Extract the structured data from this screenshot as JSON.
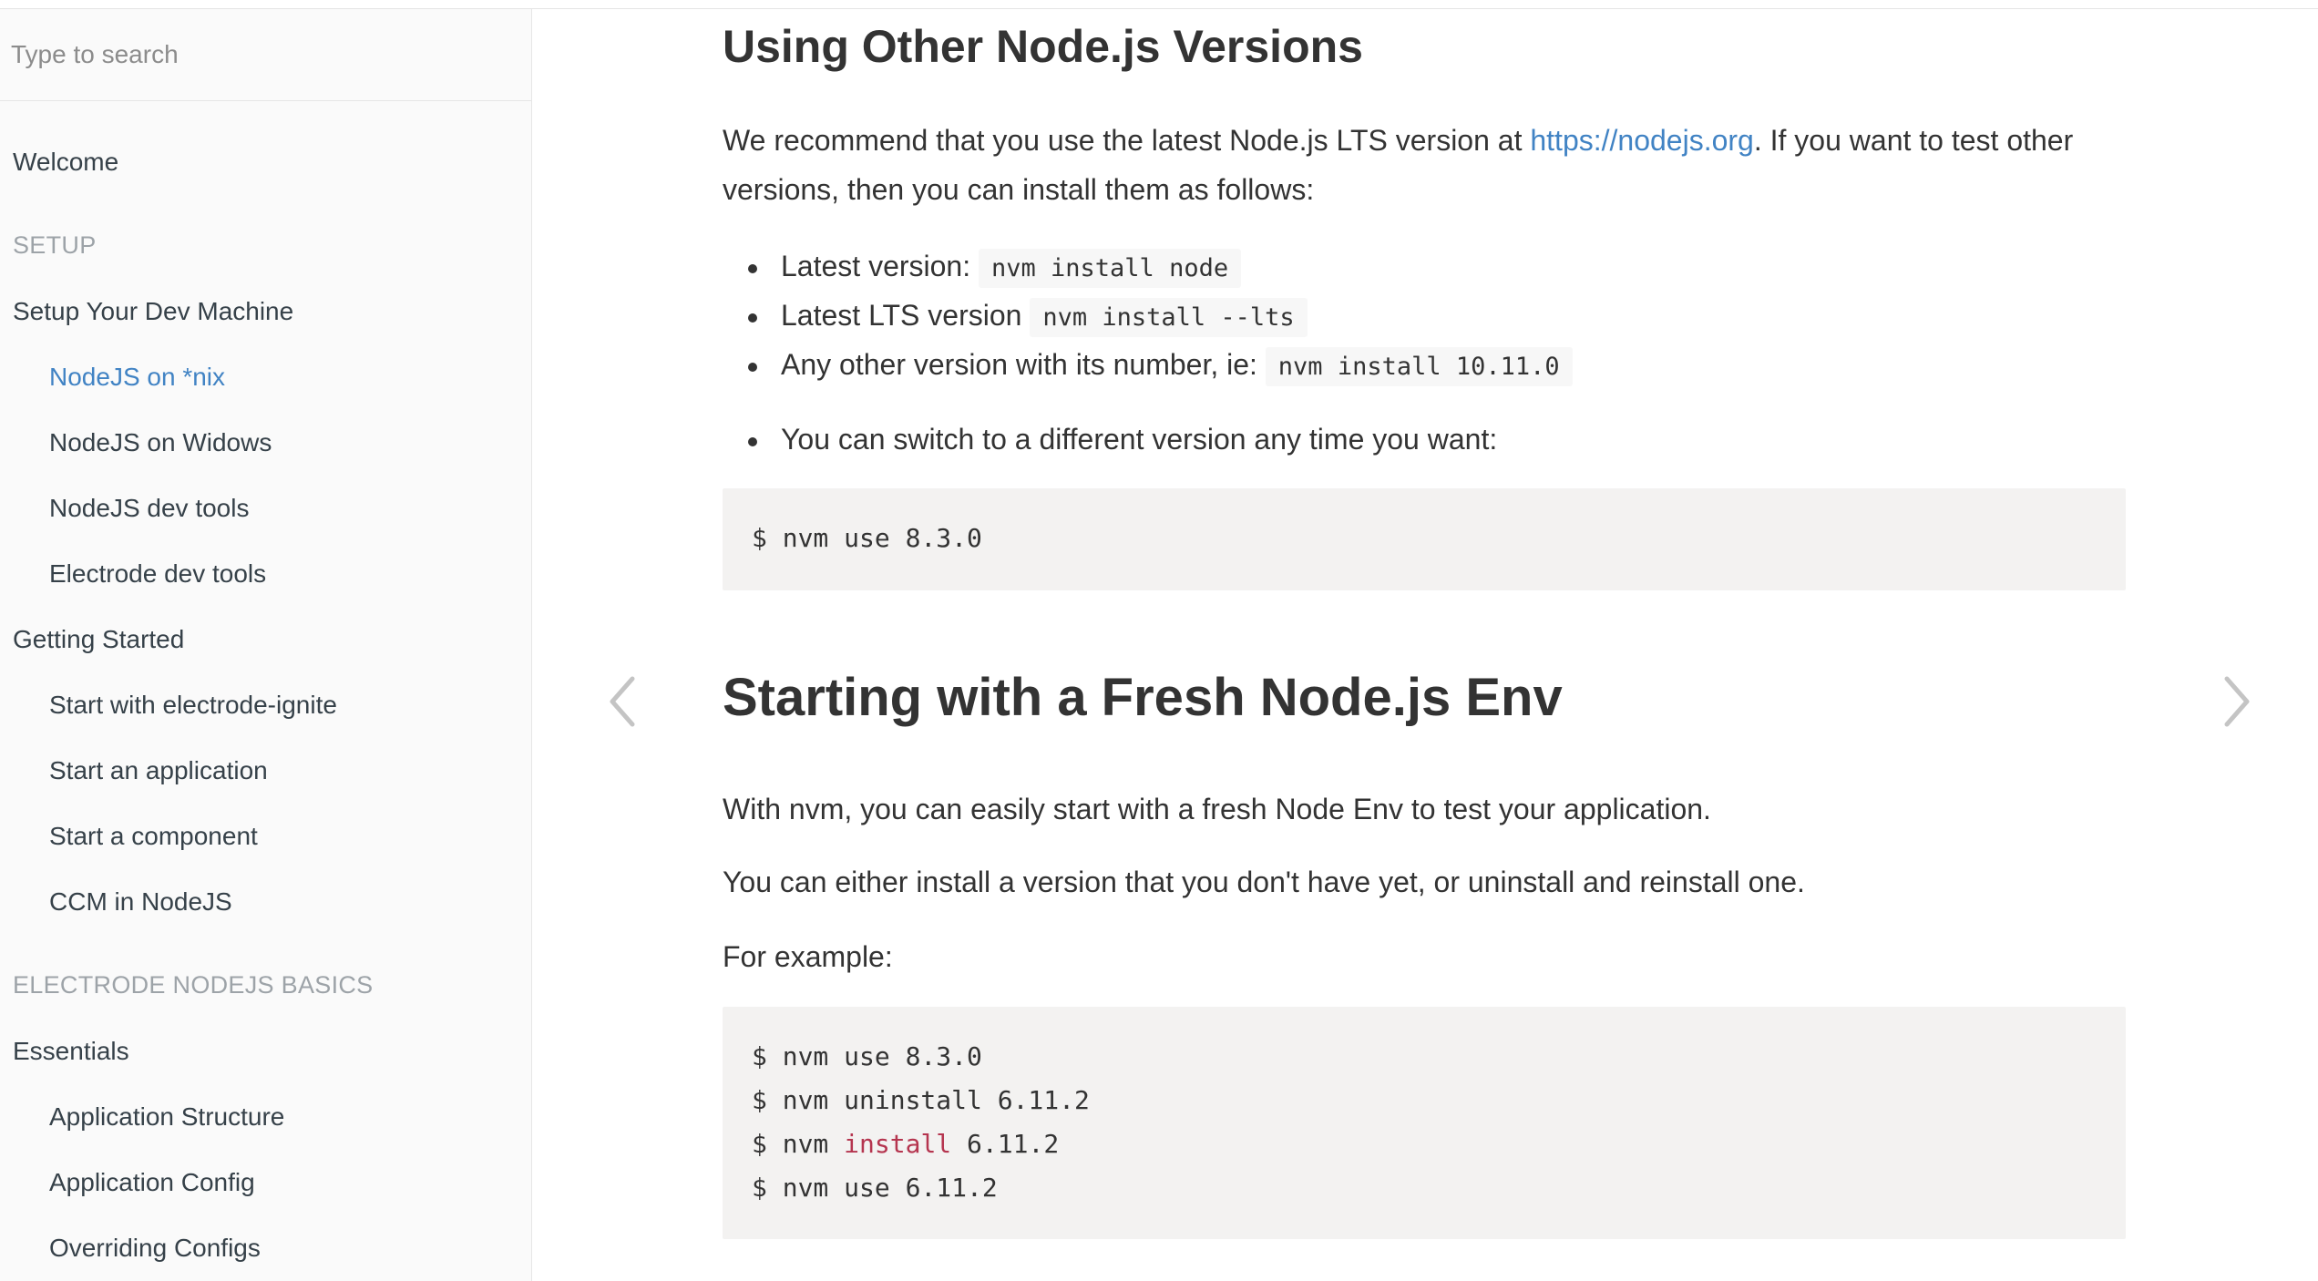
{
  "search": {
    "placeholder": "Type to search"
  },
  "sidebar": {
    "welcome": "Welcome",
    "setup_header": "SETUP",
    "setup_items": [
      "Setup Your Dev Machine",
      "NodeJS on *nix",
      "NodeJS on Widows",
      "NodeJS dev tools",
      "Electrode dev tools",
      "Getting Started",
      "Start with electrode-ignite",
      "Start an application",
      "Start a component",
      "CCM in NodeJS"
    ],
    "basics_header": "ELECTRODE NODEJS BASICS",
    "basics_items": [
      "Essentials",
      "Application Structure",
      "Application Config",
      "Overriding Configs"
    ]
  },
  "content": {
    "section1": {
      "title": "Using Other Node.js Versions",
      "intro_before_link": "We recommend that you use the latest Node.js LTS version at ",
      "link_text": "https://nodejs.org",
      "intro_after_link": ". If you want to test other versions, then you can install them as follows:",
      "bullets": [
        {
          "text": "Latest version: ",
          "code": "nvm install node"
        },
        {
          "text": "Latest LTS version ",
          "code": "nvm install --lts"
        },
        {
          "text": "Any other version with its number, ie: ",
          "code": "nvm install 10.11.0"
        },
        {
          "text": "You can switch to a different version any time you want:",
          "code": ""
        }
      ],
      "code_lines": [
        "$ nvm use 8.3.0"
      ]
    },
    "section2": {
      "title": "Starting with a Fresh Node.js Env",
      "para1": "With nvm, you can easily start with a fresh Node Env to test your application.",
      "para2": "You can either install a version that you don't have yet, or uninstall and reinstall one.",
      "para3": "For example:",
      "code_lines": [
        {
          "pre": "$ nvm use 8.3.0",
          "kw": "",
          "post": ""
        },
        {
          "pre": "$ nvm uninstall 6.11.2",
          "kw": "",
          "post": ""
        },
        {
          "pre": "$ nvm ",
          "kw": "install",
          "post": " 6.11.2"
        },
        {
          "pre": "$ nvm use 6.11.2",
          "kw": "",
          "post": ""
        }
      ]
    }
  },
  "nav_arrows": {
    "prev": "chevron-left-icon",
    "next": "chevron-right-icon"
  },
  "colors": {
    "link": "#4183c4",
    "sidebar_bg": "#fafafa",
    "code_bg": "#f3f2f1",
    "keyword": "#b5354f"
  }
}
